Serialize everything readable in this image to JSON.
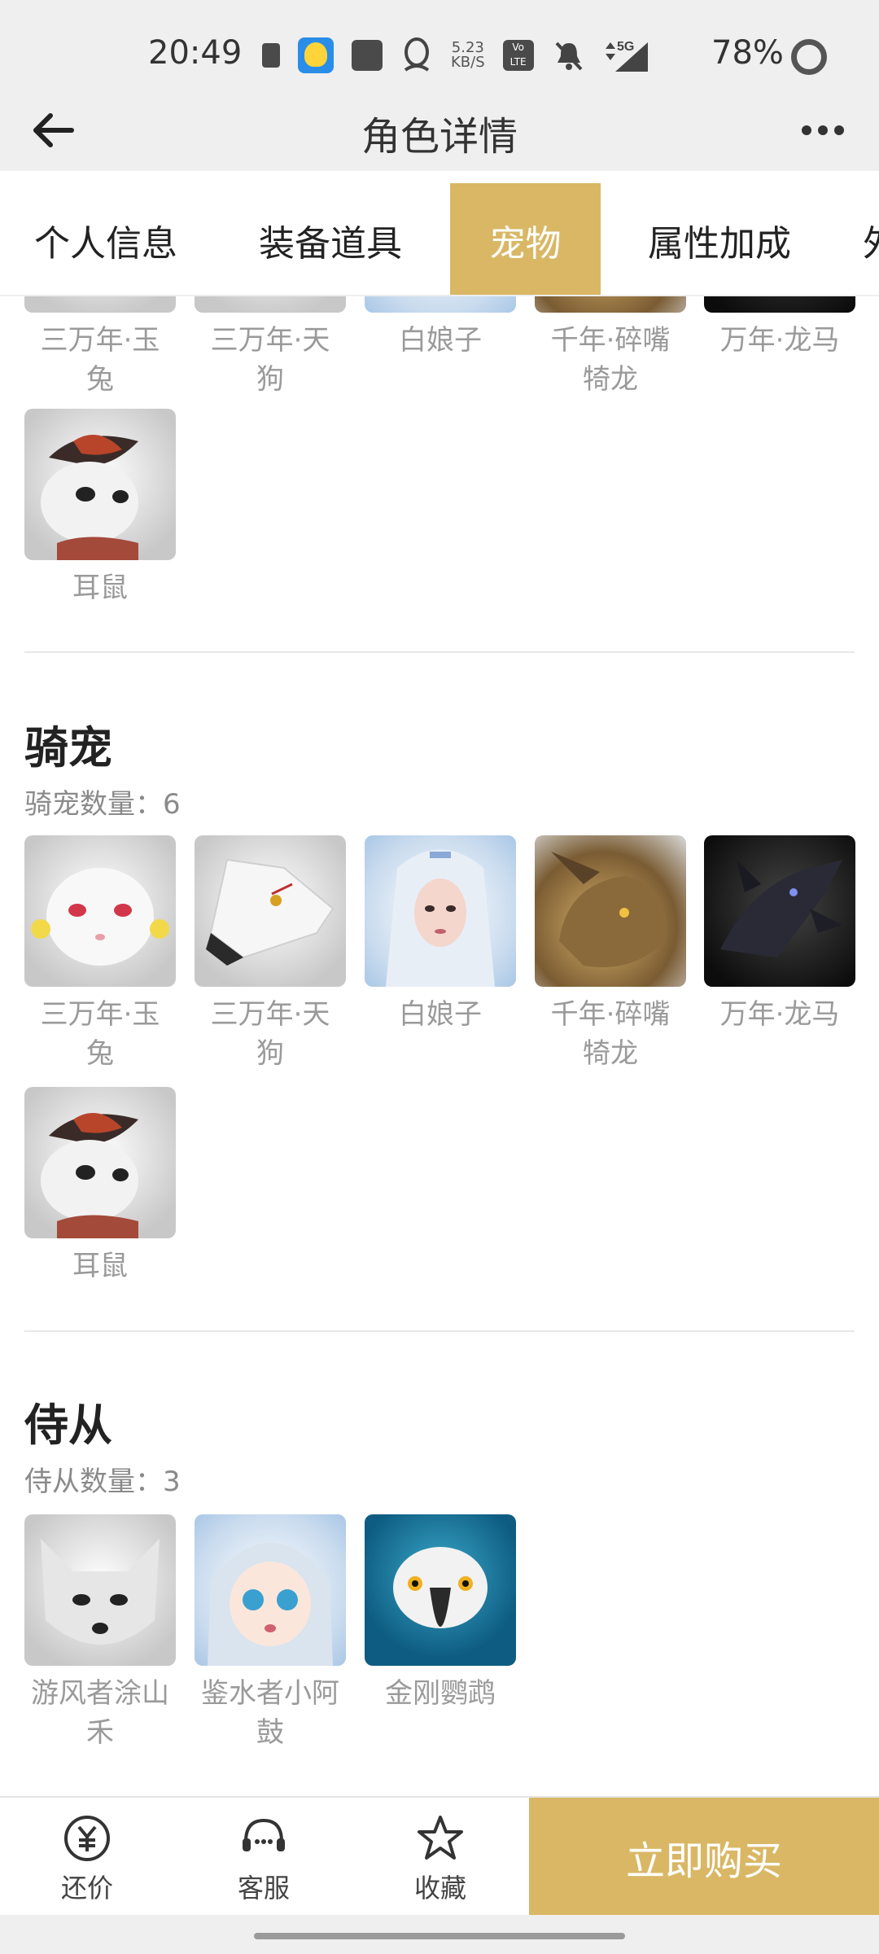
{
  "status_bar": {
    "time": "20:49",
    "net_speed": "5.23",
    "net_unit": "KB/S",
    "volte": "Vo LTE",
    "signal": "5G",
    "battery": "78%"
  },
  "header": {
    "title": "角色详情"
  },
  "tabs": [
    {
      "label": "个人信息",
      "active": false
    },
    {
      "label": "装备道具",
      "active": false
    },
    {
      "label": "宠物",
      "active": true
    },
    {
      "label": "属性加成",
      "active": false
    },
    {
      "label": "外",
      "active": false
    }
  ],
  "partial_section": {
    "items": [
      {
        "name_line1": "三万年·玉",
        "name_line2": "兔"
      },
      {
        "name_line1": "三万年·天",
        "name_line2": "狗"
      },
      {
        "name_line1": "白娘子",
        "name_line2": ""
      },
      {
        "name_line1": "千年·碎嘴",
        "name_line2": "犄龙"
      },
      {
        "name_line1": "万年·龙马",
        "name_line2": ""
      },
      {
        "name_line1": "耳鼠",
        "name_line2": ""
      }
    ]
  },
  "mount_section": {
    "title": "骑宠",
    "count_label": "骑宠数量：",
    "count": "6",
    "items": [
      {
        "name_line1": "三万年·玉",
        "name_line2": "兔"
      },
      {
        "name_line1": "三万年·天",
        "name_line2": "狗"
      },
      {
        "name_line1": "白娘子",
        "name_line2": ""
      },
      {
        "name_line1": "千年·碎嘴",
        "name_line2": "犄龙"
      },
      {
        "name_line1": "万年·龙马",
        "name_line2": ""
      },
      {
        "name_line1": "耳鼠",
        "name_line2": ""
      }
    ]
  },
  "follower_section": {
    "title": "侍从",
    "count_label": "侍从数量：",
    "count": "3",
    "items": [
      {
        "name_line1": "游风者涂山",
        "name_line2": "禾"
      },
      {
        "name_line1": "鉴水者小阿",
        "name_line2": "鼓"
      },
      {
        "name_line1": "金刚鹦鹉",
        "name_line2": ""
      }
    ]
  },
  "bottom_bar": {
    "bargain_label": "还价",
    "service_label": "客服",
    "favorite_label": "收藏",
    "buy_label": "立即购买"
  },
  "colors": {
    "accent": "#d9b765",
    "label_grey": "#9a9a9a",
    "background_grey": "#efefef"
  }
}
